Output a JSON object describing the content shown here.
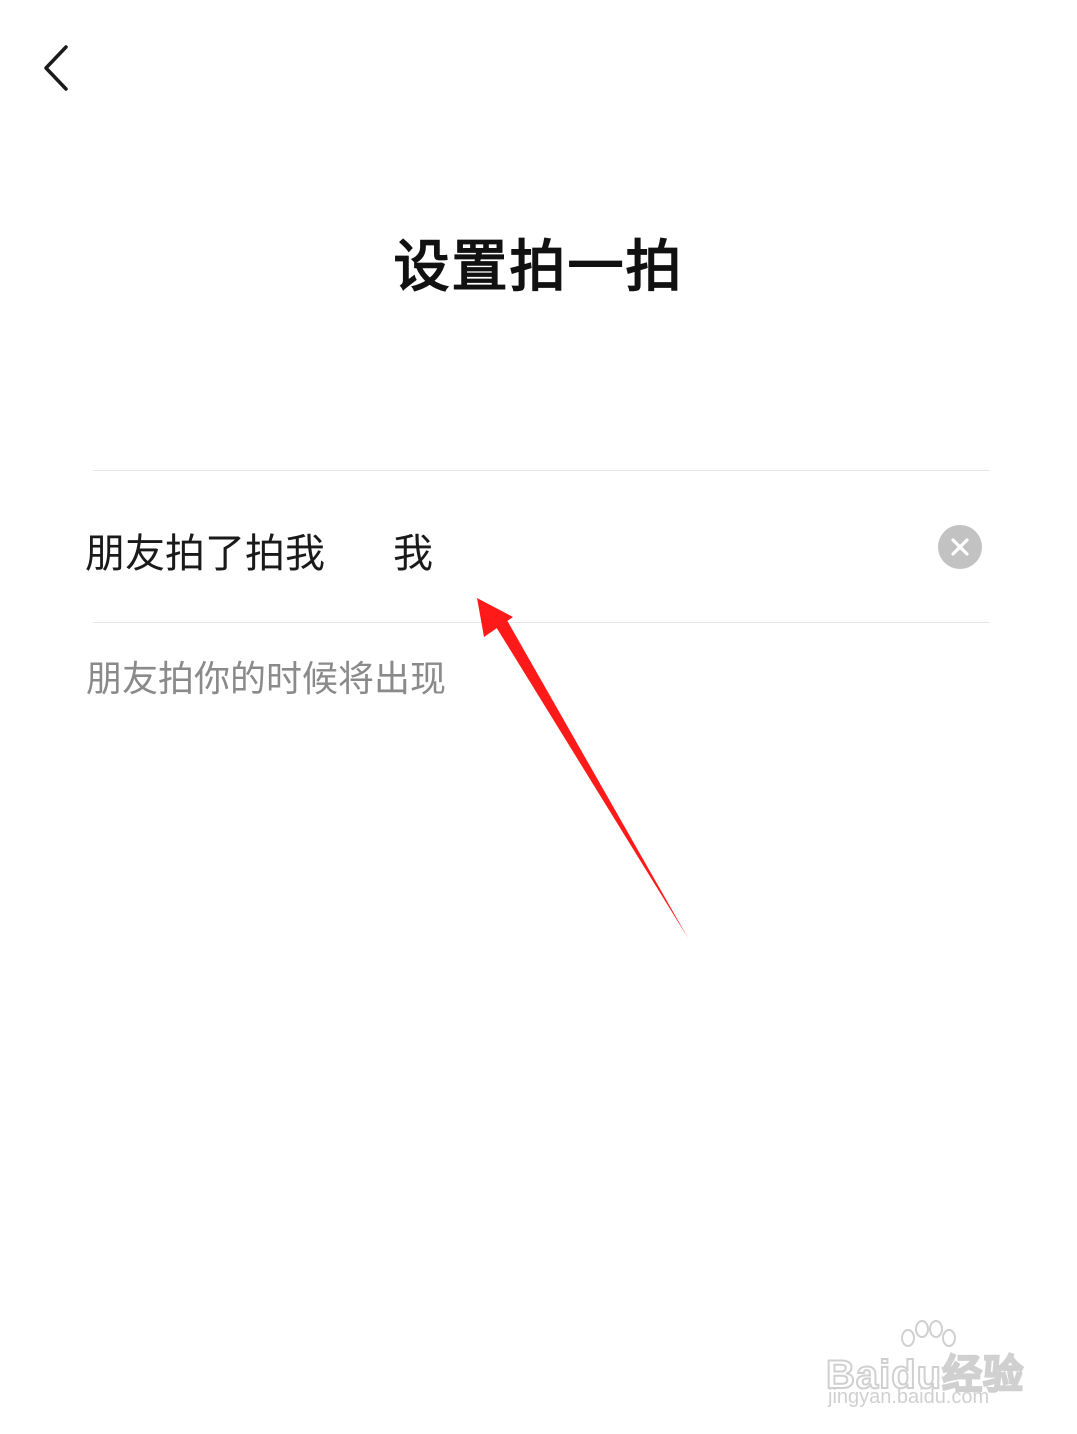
{
  "header": {
    "back_icon": "chevron-left-icon",
    "title": "设置拍一拍"
  },
  "pat_setting": {
    "prefix_label": "朋友拍了拍我",
    "input_value": "我",
    "clear_icon": "clear-circle-icon",
    "hint": "朋友拍你的时候将出现"
  },
  "annotation": {
    "arrow_color": "#ff1a1a"
  },
  "watermark": {
    "brand": "Baidu经验",
    "url": "jingyan.baidu.com"
  }
}
